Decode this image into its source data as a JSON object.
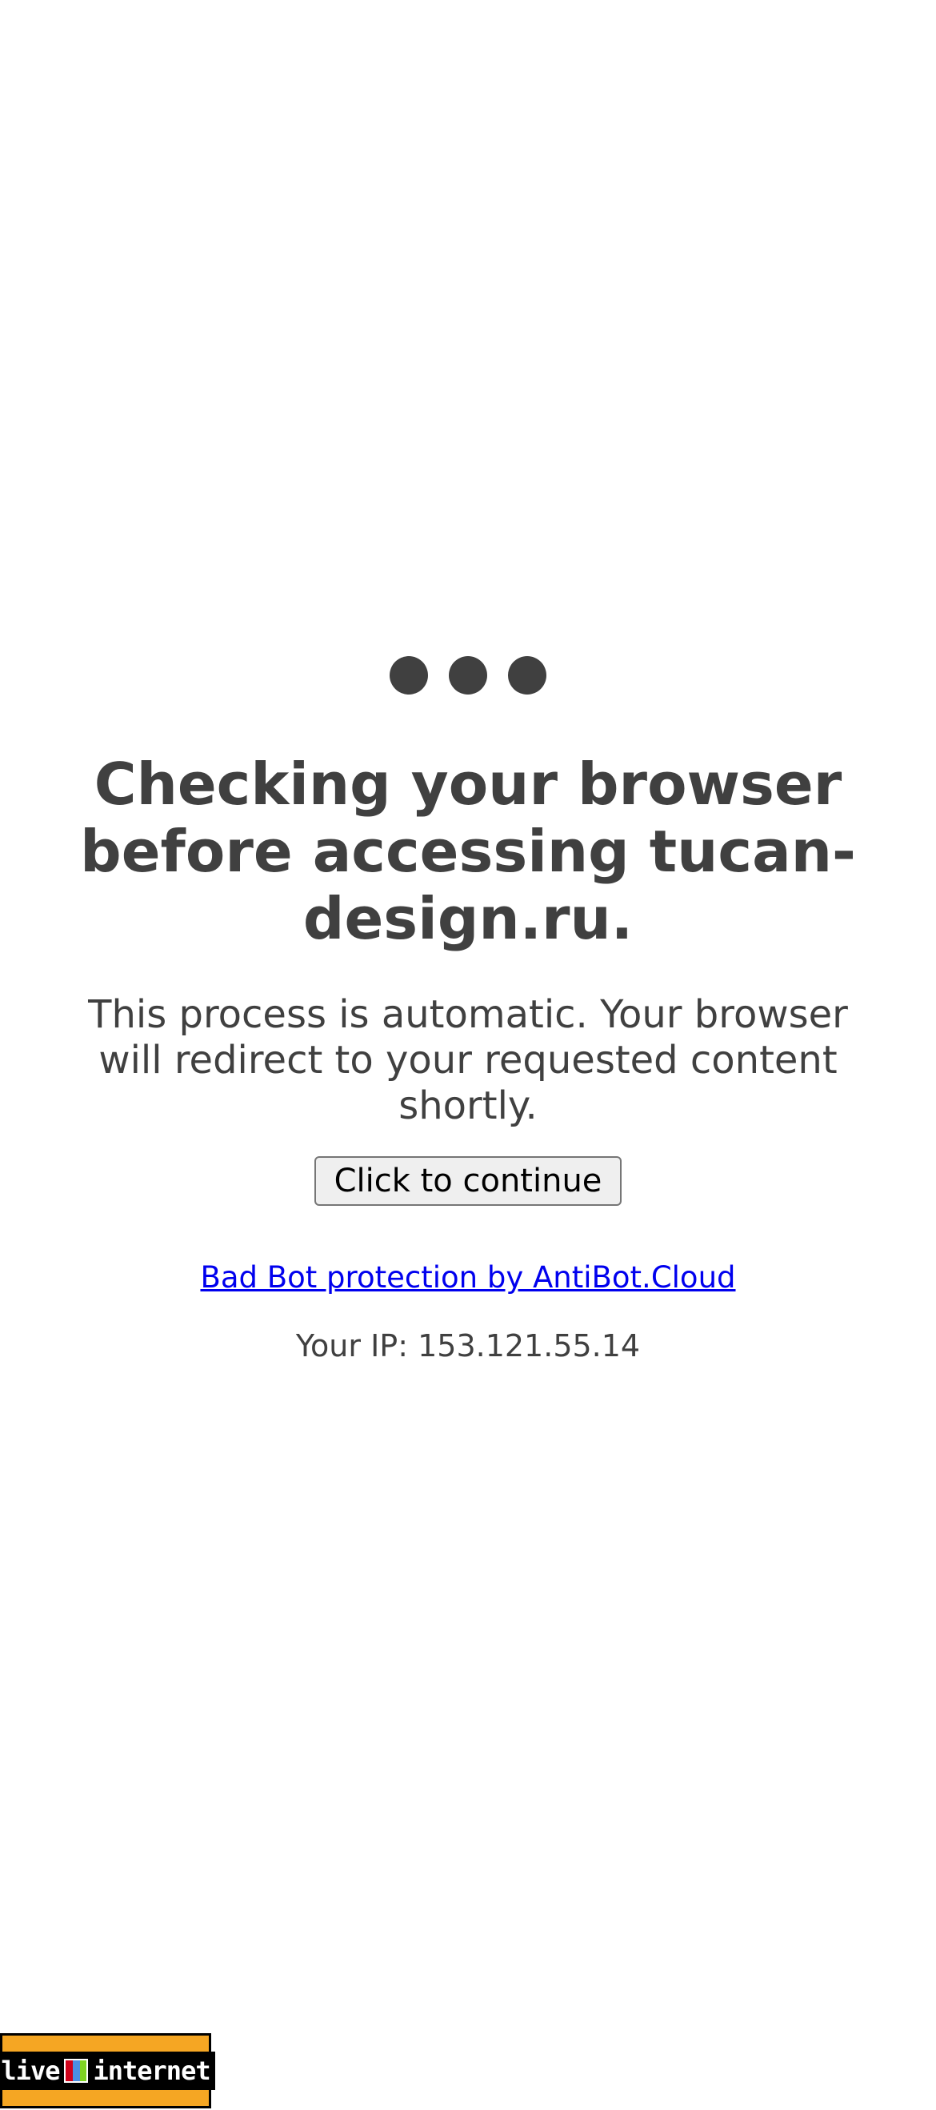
{
  "challenge": {
    "heading": "Checking your browser before accessing tucan-design.ru.",
    "description": "This process is automatic. Your browser will redirect to your requested content shortly.",
    "continue_button_label": "Click to continue",
    "protection_link_text": "Bad Bot protection by AntiBot.Cloud",
    "ip_text": "Your IP: 153.121.55.14"
  },
  "colors": {
    "text": "#404040",
    "link": "#0000ee",
    "badge_background": "#f5a623"
  },
  "counter_badge": {
    "text_left": "live",
    "text_right": "internet",
    "icon": "liveinternet-logo-icon"
  }
}
